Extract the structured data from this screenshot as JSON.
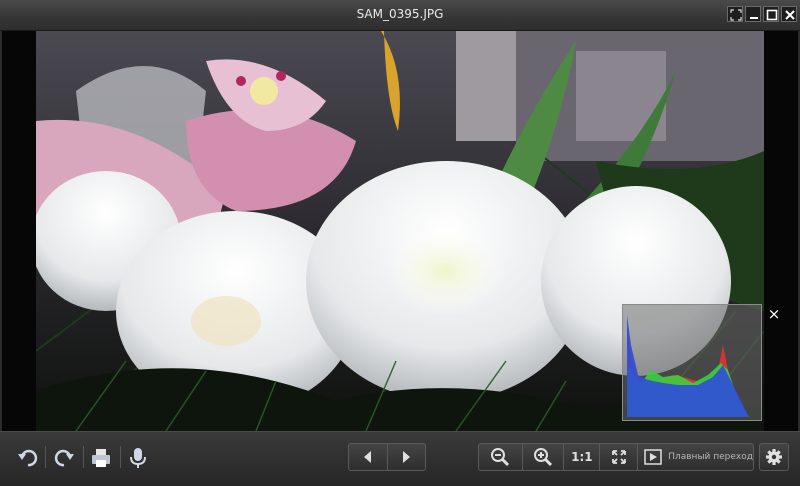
{
  "window": {
    "title": "SAM_0395.JPG",
    "controls": [
      "fullscreen-icon",
      "minimize-icon",
      "maximize-icon",
      "close-icon"
    ]
  },
  "viewer": {
    "histogram": {
      "close_label": "×",
      "channels": [
        "red",
        "green",
        "blue"
      ]
    }
  },
  "toolbar": {
    "left_icons": [
      "rotate-left-icon",
      "rotate-right-icon",
      "print-icon",
      "microphone-icon"
    ],
    "nav_icons": [
      "previous-icon",
      "next-icon"
    ],
    "zoom_out_icon": "zoom-out-icon",
    "zoom_in_icon": "zoom-in-icon",
    "actual_size_label": "1:1",
    "fit_icon": "fit-to-window-icon",
    "slideshow_icon": "slideshow-icon",
    "smooth_transition_label": "Плавный переход",
    "settings_icon": "gear-icon"
  },
  "colors": {
    "chrome": "#2b2b2b",
    "histogram_red": "#e53030",
    "histogram_green": "#3ccf3c",
    "histogram_blue": "#3050d8"
  }
}
